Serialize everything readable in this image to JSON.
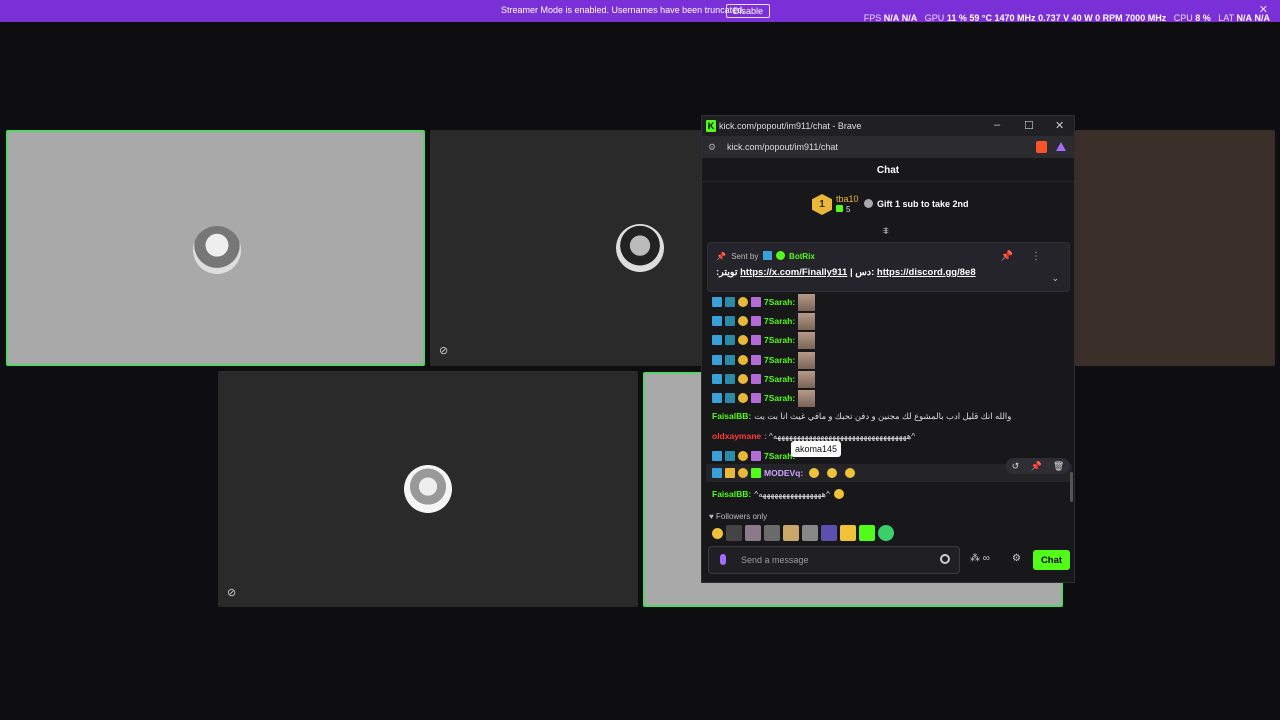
{
  "topbar": {
    "message": "Streamer Mode is enabled. Usernames have been truncated.",
    "disable_label": "Disable",
    "stats": {
      "fps_label": "FPS",
      "fps1": "N/A",
      "fps2": "N/A",
      "gpu_label": "GPU",
      "gpu_load": "11 %",
      "gpu_temp": "59 °C",
      "gpu_clock": "1470 MHz",
      "gpu_volt": "0.737 V",
      "gpu_power": "40 W",
      "gpu_rpm": "0 RPM",
      "gpu_mem": "7000 MHz",
      "cpu_label": "CPU",
      "cpu_load": "8 %",
      "lat_label": "LAT",
      "lat1": "N/A",
      "lat2": "N/A"
    }
  },
  "browser": {
    "window_title": "kick.com/popout/im911/chat - Brave",
    "url": "kick.com/popout/im911/chat"
  },
  "chat": {
    "header": "Chat",
    "leaderboard": {
      "rank": "1",
      "username": "tba10",
      "count": "5",
      "gift_text": "Gift 1 sub to take 2nd"
    },
    "pinned": {
      "sent_by": "Sent by",
      "author": "BotRix",
      "text_prefix": ":تويتر",
      "link1": "https://x.com/Finally911",
      "separator": " | دس: ",
      "link2": "https://discord.gg/8e8"
    },
    "messages": [
      {
        "user": "7Sarah:"
      },
      {
        "user": "7Sarah:"
      },
      {
        "user": "7Sarah:"
      },
      {
        "user": "7Sarah:"
      },
      {
        "user": "7Sarah:"
      },
      {
        "user": "7Sarah:"
      },
      {
        "user": "FaisalBB:",
        "text": "والله انك قليل ادب بالمشوع لك مجنين و دفن تحبك و مافي غيث انا بت بت"
      },
      {
        "user": "oldxaymane",
        "text": ": ^ههههههههههههههههههههههههههههههههههه^"
      },
      {
        "user": "7Sarah:"
      },
      {
        "user": "MODEVq:"
      },
      {
        "user": "FaisalBB:",
        "text": "^ههههههههههههههههه^"
      }
    ],
    "tooltip": "akoma145",
    "followers_only": "Followers only",
    "input_placeholder": "Send a message",
    "send_label": "Chat"
  },
  "colors": {
    "kick_green": "#53fc18",
    "streamer_bar": "#7b2fd6",
    "active_border": "#53d769"
  }
}
